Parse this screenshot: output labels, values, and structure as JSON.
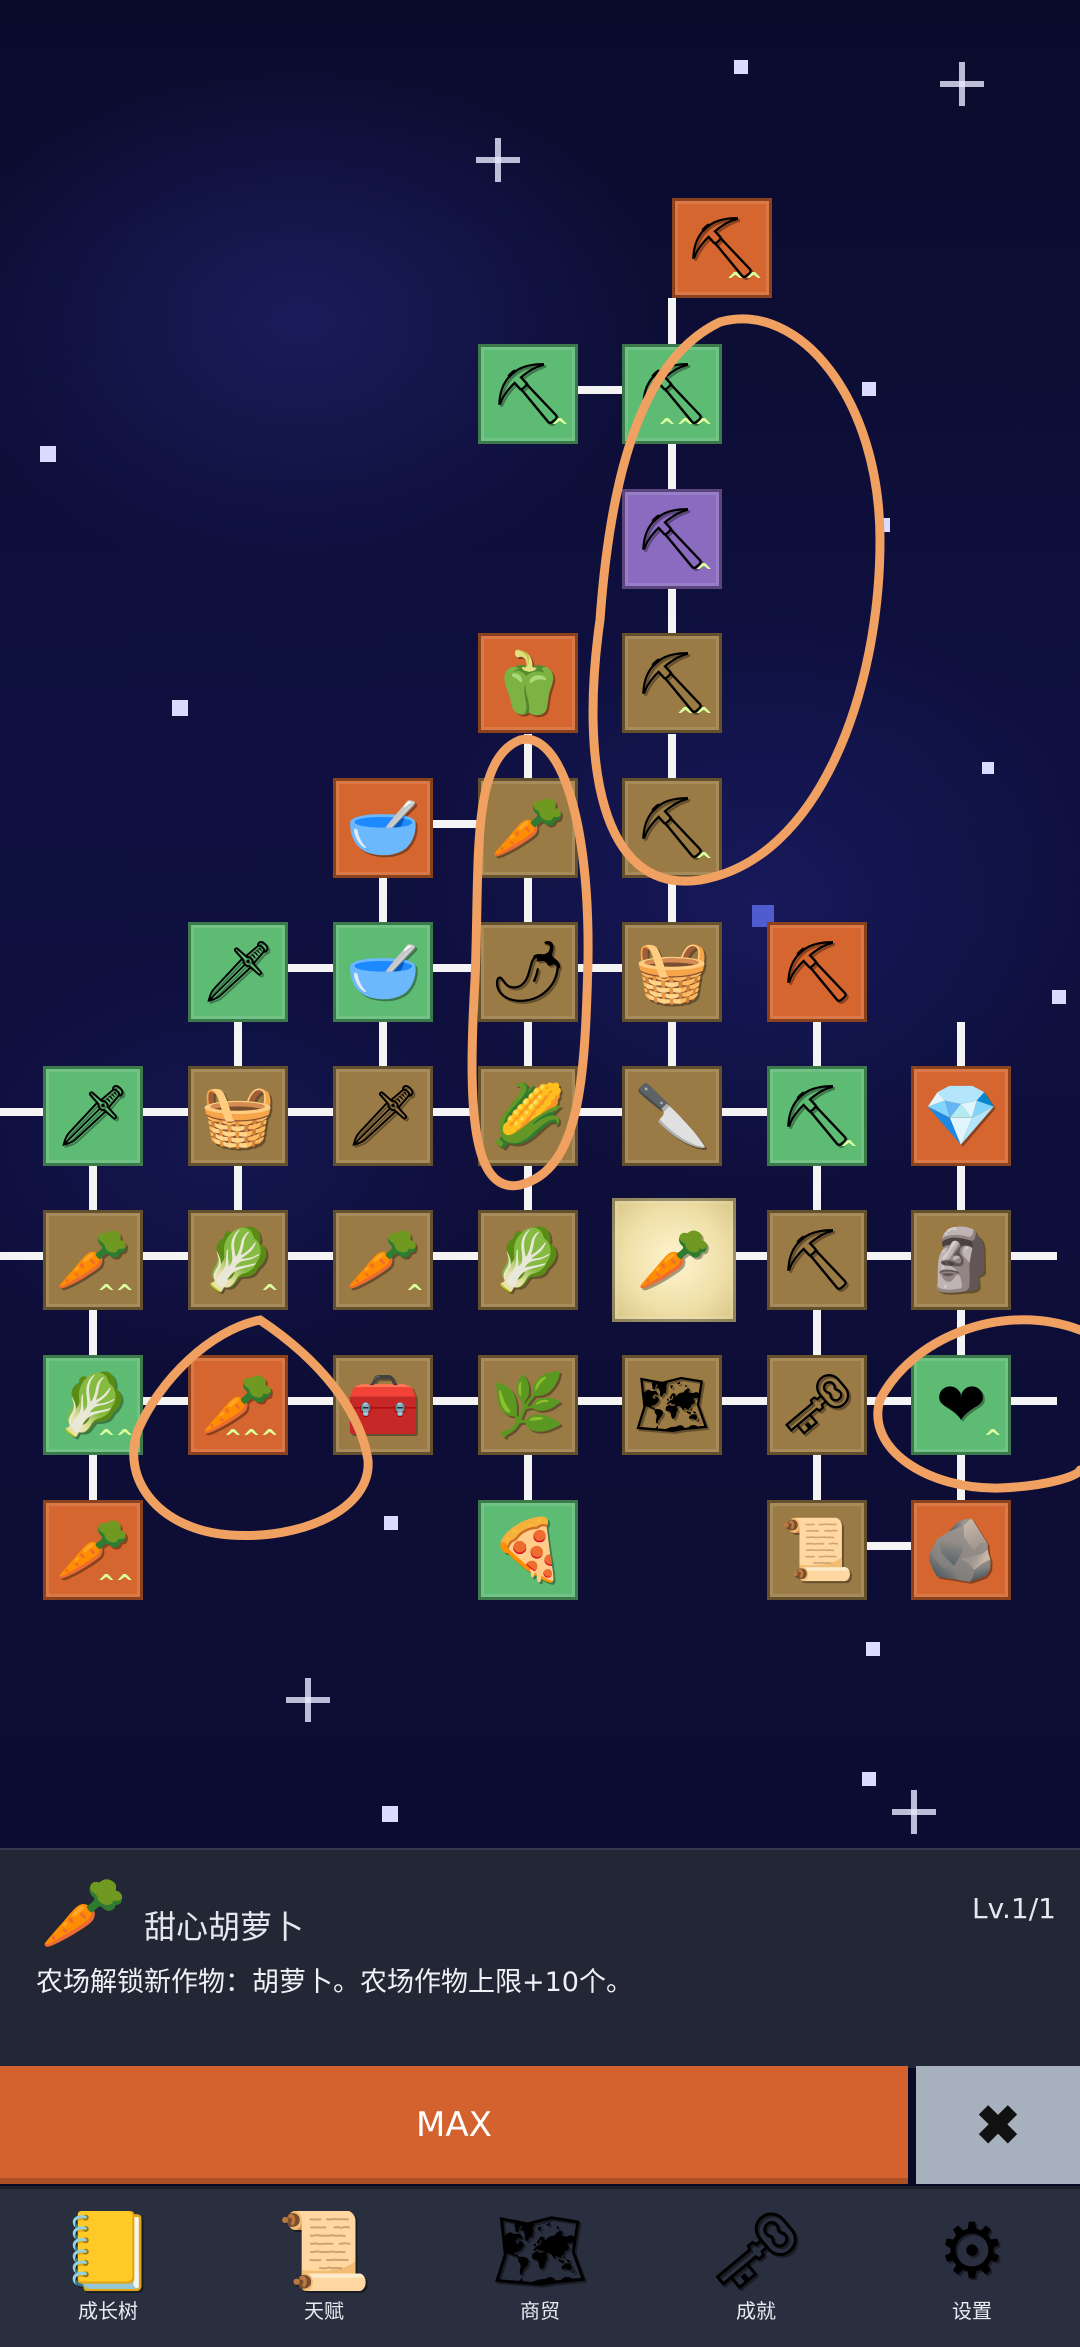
{
  "tree": {
    "nodes": [
      {
        "name": "shovel-icon",
        "glyph": "⛏",
        "color": "orange",
        "chev": "^^"
      },
      {
        "name": "shovel-icon",
        "glyph": "⛏",
        "color": "green",
        "chev": "^"
      },
      {
        "name": "shovel-icon",
        "glyph": "⛏",
        "color": "green",
        "chev": "^^^"
      },
      {
        "name": "shovel-icon",
        "glyph": "⛏",
        "color": "purple",
        "chev": "^"
      },
      {
        "name": "bell-pepper-icon",
        "glyph": "🫑",
        "color": "orange",
        "chev": ""
      },
      {
        "name": "shovel-icon",
        "glyph": "⛏",
        "color": "brown",
        "chev": "^^"
      },
      {
        "name": "bowl-icon",
        "glyph": "🥣",
        "color": "orange",
        "chev": ""
      },
      {
        "name": "radish-icon",
        "glyph": "🥕",
        "color": "brown",
        "chev": ""
      },
      {
        "name": "shovel-icon",
        "glyph": "⛏",
        "color": "brown",
        "chev": "^"
      },
      {
        "name": "sword-icon",
        "glyph": "🗡",
        "color": "green",
        "chev": ""
      },
      {
        "name": "bowl-icon",
        "glyph": "🥣",
        "color": "green",
        "chev": ""
      },
      {
        "name": "chili-icon",
        "glyph": "🌶",
        "color": "brown",
        "chev": ""
      },
      {
        "name": "chest-icon",
        "glyph": "🧺",
        "color": "brown",
        "chev": ""
      },
      {
        "name": "pickaxe-icon",
        "glyph": "⛏",
        "color": "orange",
        "chev": ""
      },
      {
        "name": "sword-icon",
        "glyph": "🗡",
        "color": "green",
        "chev": ""
      },
      {
        "name": "chest-icon",
        "glyph": "🧺",
        "color": "brown",
        "chev": ""
      },
      {
        "name": "sword-icon",
        "glyph": "🗡",
        "color": "brown",
        "chev": ""
      },
      {
        "name": "corn-icon",
        "glyph": "🌽",
        "color": "brown",
        "chev": ""
      },
      {
        "name": "dagger-icon",
        "glyph": "🔪",
        "color": "brown",
        "chev": ""
      },
      {
        "name": "pickaxe-icon",
        "glyph": "⛏",
        "color": "green",
        "chev": "^"
      },
      {
        "name": "crystal-icon",
        "glyph": "💎",
        "color": "orange",
        "chev": ""
      },
      {
        "name": "carrot-icon",
        "glyph": "🥕",
        "color": "brown",
        "chev": "^^"
      },
      {
        "name": "cabbage-icon",
        "glyph": "🥬",
        "color": "brown",
        "chev": "^"
      },
      {
        "name": "carrot-icon",
        "glyph": "🥕",
        "color": "brown",
        "chev": "^"
      },
      {
        "name": "cabbage-icon",
        "glyph": "🥬",
        "color": "brown",
        "chev": ""
      },
      {
        "name": "carrot-icon",
        "glyph": "🥕",
        "color": "center",
        "chev": ""
      },
      {
        "name": "pickaxe-icon",
        "glyph": "⛏",
        "color": "brown",
        "chev": ""
      },
      {
        "name": "statue-icon",
        "glyph": "🗿",
        "color": "brown",
        "chev": ""
      },
      {
        "name": "cabbage-icon",
        "glyph": "🥬",
        "color": "green",
        "chev": "^^"
      },
      {
        "name": "carrot-icon",
        "glyph": "🥕",
        "color": "orange",
        "chev": "^^^"
      },
      {
        "name": "treasure-chest-icon",
        "glyph": "🧰",
        "color": "brown",
        "chev": ""
      },
      {
        "name": "leek-icon",
        "glyph": "🌿",
        "color": "brown",
        "chev": ""
      },
      {
        "name": "map-icon",
        "glyph": "🗺",
        "color": "brown",
        "chev": ""
      },
      {
        "name": "key-icon",
        "glyph": "🗝",
        "color": "brown",
        "chev": ""
      },
      {
        "name": "heart-icon",
        "glyph": "❤",
        "color": "green",
        "chev": "^"
      },
      {
        "name": "carrot-icon",
        "glyph": "🥕",
        "color": "orange",
        "chev": "^^"
      },
      {
        "name": "pizza-icon",
        "glyph": "🍕",
        "color": "green",
        "chev": ""
      },
      {
        "name": "scroll-icon",
        "glyph": "📜",
        "color": "brown",
        "chev": ""
      },
      {
        "name": "fossil-icon",
        "glyph": "🪨",
        "color": "orange",
        "chev": ""
      }
    ]
  },
  "detail": {
    "icon": "🥕",
    "name": "甜心胡萝卜",
    "level": "Lv.1/1",
    "description": "农场解锁新作物：胡萝卜。农场作物上限+10个。"
  },
  "actions": {
    "max_label": "MAX",
    "close_glyph": "✖"
  },
  "nav": {
    "items": [
      {
        "label": "成长树",
        "icon": "📒"
      },
      {
        "label": "天赋",
        "icon": "📜"
      },
      {
        "label": "商贸",
        "icon": "🗺"
      },
      {
        "label": "成就",
        "icon": "🗝"
      },
      {
        "label": "设置",
        "icon": "⚙"
      }
    ]
  },
  "colors": {
    "node_orange": "#d5662f",
    "node_green": "#5dbb74",
    "node_brown": "#9b7b45",
    "node_purple": "#8a6bc0",
    "max_button": "#d4622f",
    "close_button": "#a7b1be",
    "annotation": "#f0a060"
  }
}
